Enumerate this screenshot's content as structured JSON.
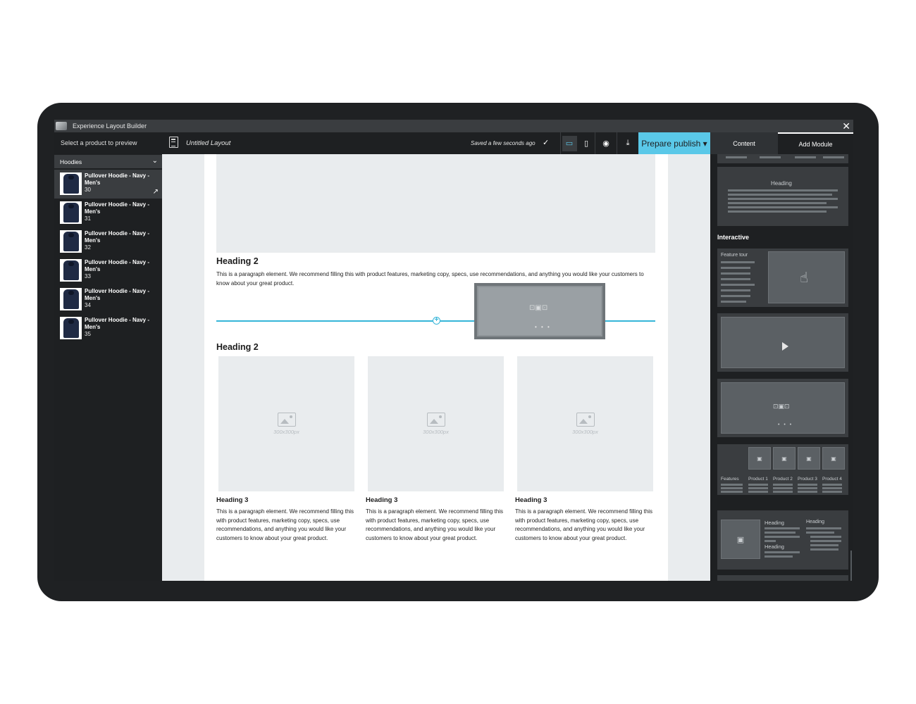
{
  "app": {
    "title": "Experience Layout Builder",
    "close_glyph": "✕"
  },
  "toolbar": {
    "product_label": "Select a product to preview",
    "layout_name": "Untitled Layout",
    "saved_status": "Saved a few seconds ago",
    "check_glyph": "✓",
    "desktop_glyph": "▭",
    "mobile_glyph": "▯",
    "preview_glyph": "◉",
    "download_glyph": "⤓",
    "publish_label": "Prepare publish ▾",
    "tabs": [
      {
        "label": "Content"
      },
      {
        "label": "Add Module"
      }
    ]
  },
  "sidebar": {
    "category": "Hoodies",
    "chevron": "⌄",
    "ext_glyph": "↗",
    "products": [
      {
        "name": "Pullover Hoodie - Navy - Men's",
        "number": "30"
      },
      {
        "name": "Pullover Hoodie - Navy - Men's",
        "number": "31"
      },
      {
        "name": "Pullover Hoodie - Navy - Men's",
        "number": "32"
      },
      {
        "name": "Pullover Hoodie - Navy - Men's",
        "number": "33"
      },
      {
        "name": "Pullover Hoodie - Navy - Men's",
        "number": "34"
      },
      {
        "name": "Pullover Hoodie - Navy - Men's",
        "number": "35"
      }
    ]
  },
  "canvas": {
    "heading_a": "Heading 2",
    "paragraph_a": "This is a paragraph element. We recommend filling this with product features, marketing copy, specs, use recommendations, and anything you would like your customers to know about your great product.",
    "heading_b": "Heading 2",
    "drop_plus": "+",
    "drag_icon": "⊡▣⊡",
    "drag_dots": "• • •",
    "cards": [
      {
        "size": "300x300px",
        "heading": "Heading 3",
        "paragraph": "This is a paragraph element. We recommend filling this with product features, marketing copy, specs, use recommendations, and anything you would like your customers to know about your great product."
      },
      {
        "size": "300x300px",
        "heading": "Heading 3",
        "paragraph": "This is a paragraph element. We recommend filling this with product features, marketing copy, specs, use recommendations, and anything you would like your customers to know about your great product."
      },
      {
        "size": "300x300px",
        "heading": "Heading 3",
        "paragraph": "This is a paragraph element. We recommend filling this with product features, marketing copy, specs, use recommendations, and anything you would like your customers to know about your great product."
      }
    ]
  },
  "modules": {
    "text_module_heading": "Heading",
    "interactive_title": "Interactive",
    "feature_tour_label": "Feature tour",
    "fingerprint_glyph": "☝",
    "carousel_icon": "⊡▣⊡",
    "carousel_dots": "• • •",
    "comparison": {
      "features_label": "Features",
      "products": [
        "Product 1",
        "Product 2",
        "Product 3",
        "Product 4"
      ],
      "image_glyph": "▣"
    },
    "mixed": {
      "heading_1": "Heading",
      "heading_2": "Heading",
      "heading_3": "Heading",
      "image_glyph": "▣"
    }
  },
  "colors": {
    "accent": "#5ac8e8",
    "dark_bg": "#1e2022",
    "panel": "#3a3d40"
  }
}
